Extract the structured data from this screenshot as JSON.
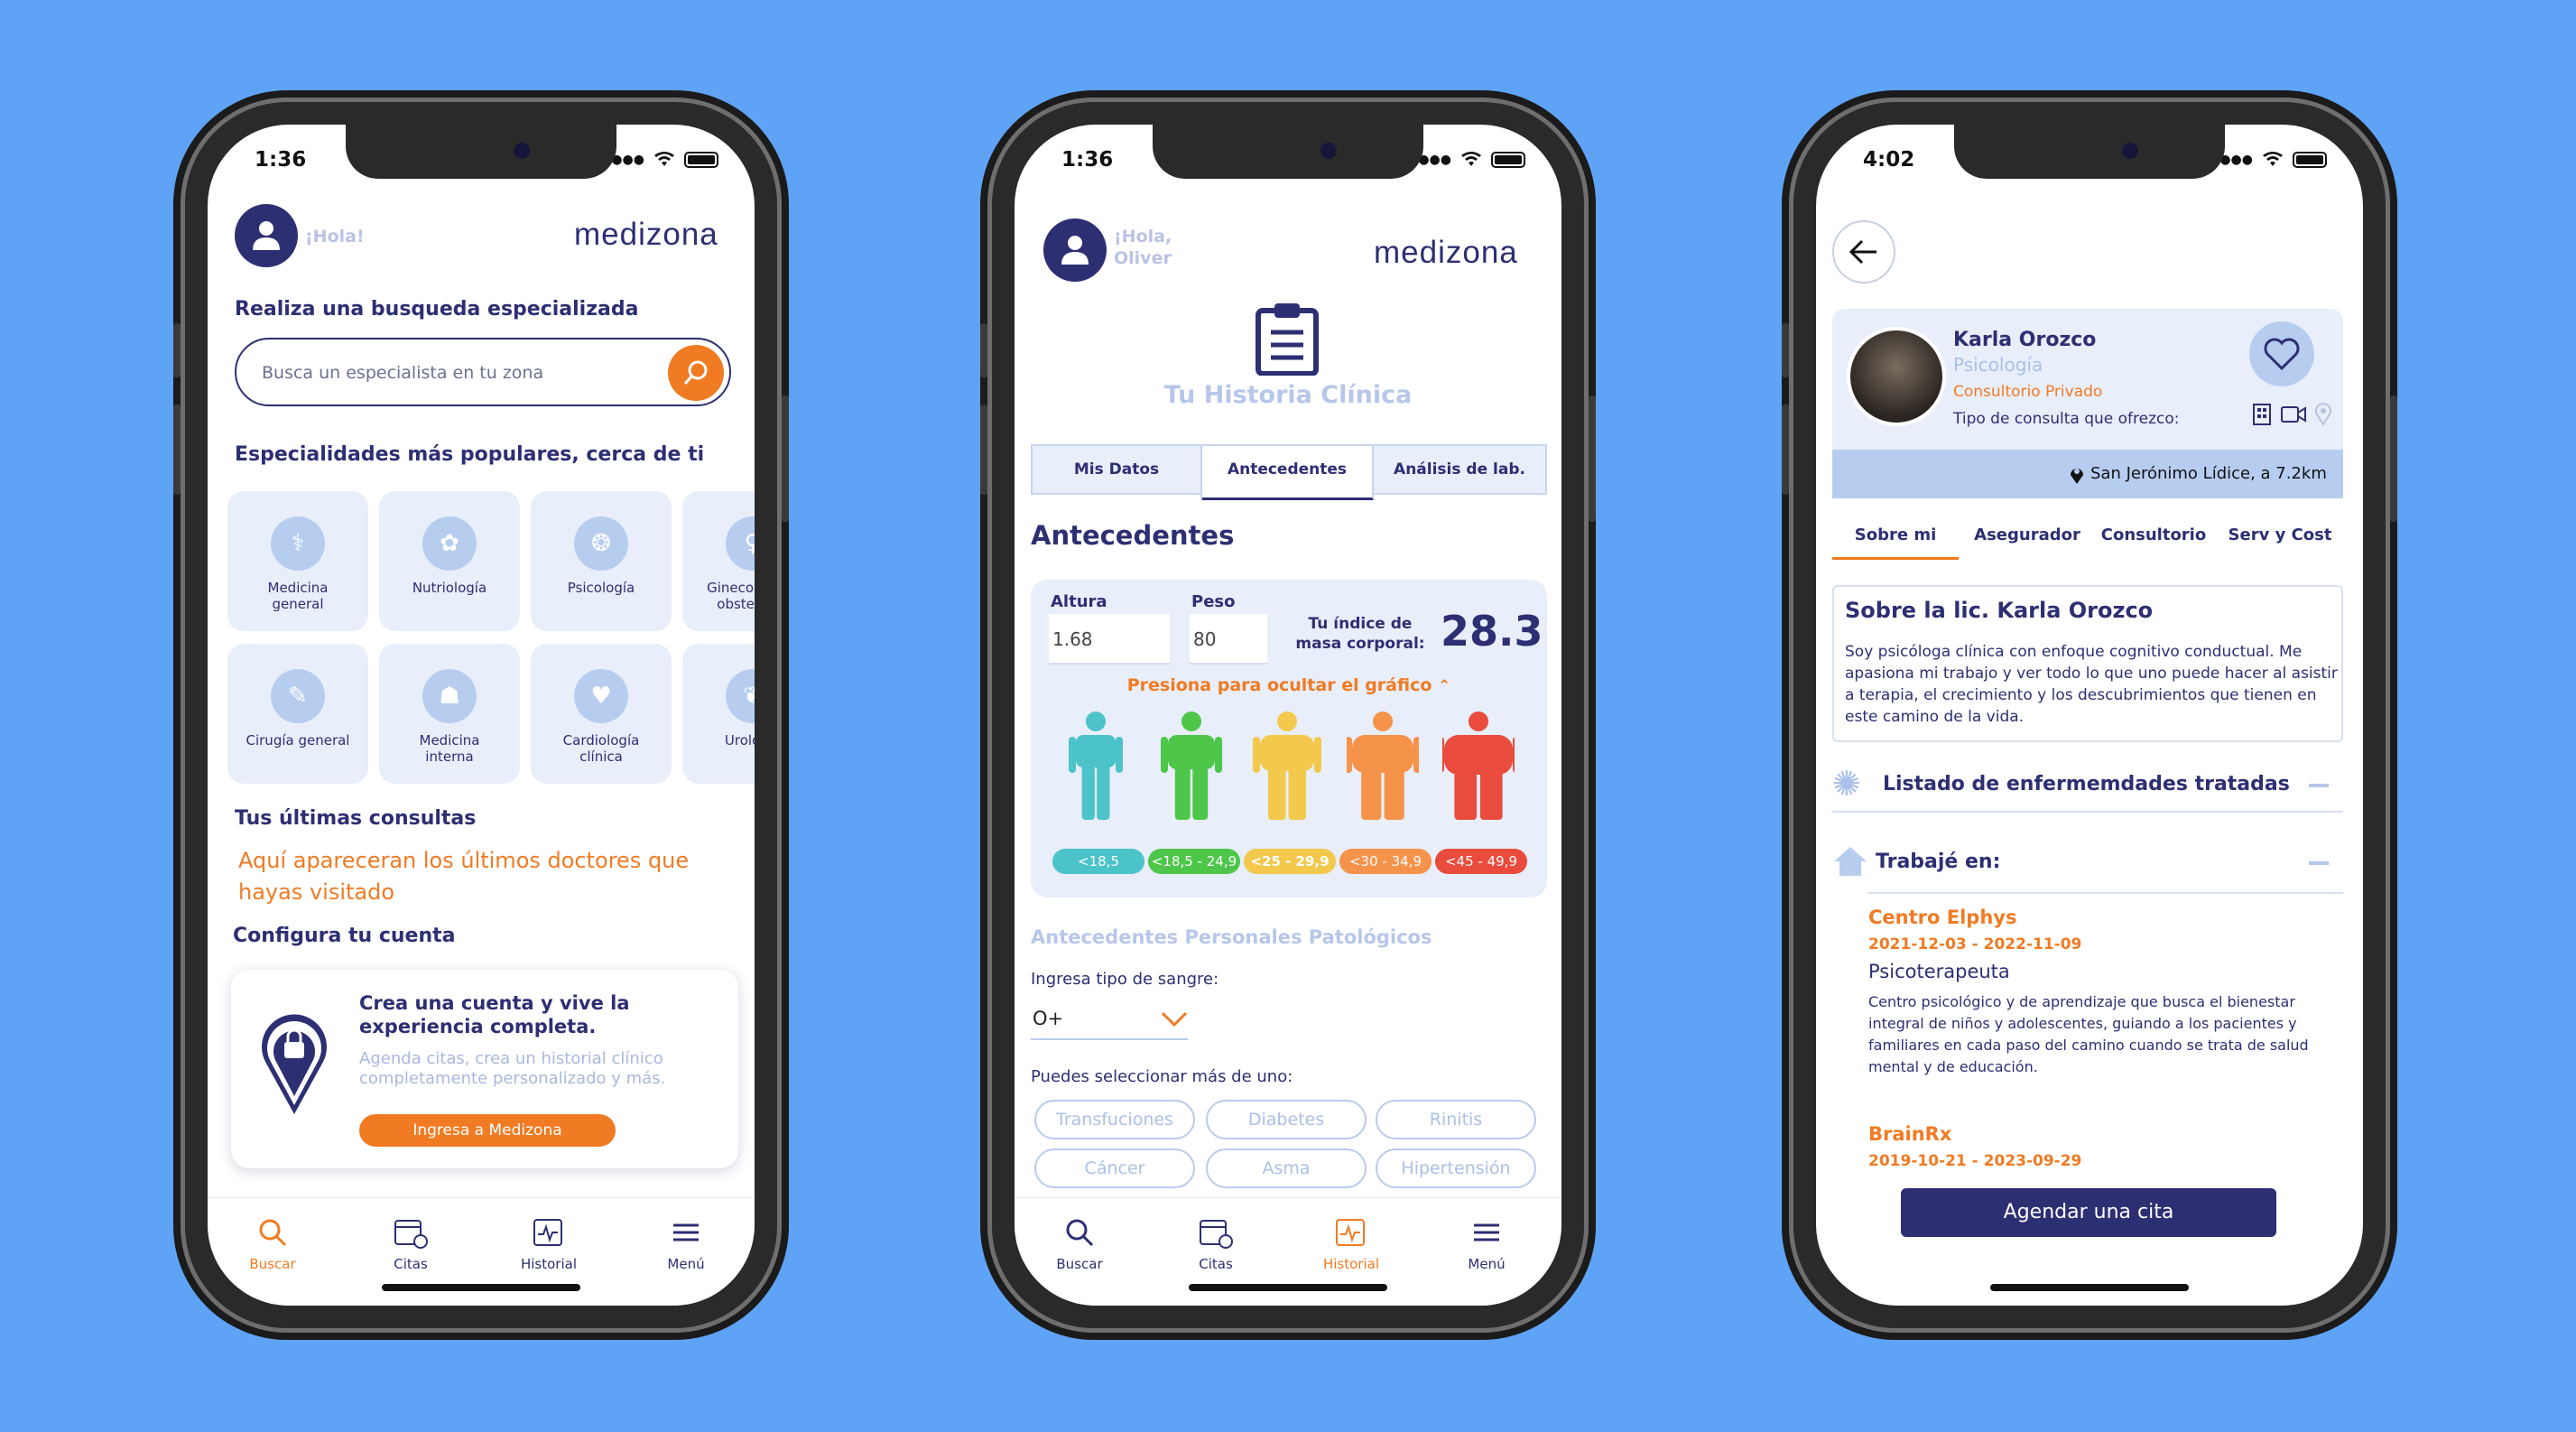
{
  "colors": {
    "background": "#5fa3f6",
    "navy": "#2d2f73",
    "orange": "#f07b23",
    "light": "#e8eefa"
  },
  "tabbar": {
    "search": "Buscar",
    "appointments": "Citas",
    "history": "Historial",
    "menu": "Menú"
  },
  "phone1": {
    "time": "1:36",
    "greeting": "¡Hola!",
    "logo": "medizona",
    "search_title": "Realiza una busqueda especializada",
    "search_placeholder": "Busca un especialista en tu zona",
    "popular_title": "Especialidades más populares, cerca de ti",
    "specialties": [
      "Medicina general",
      "Nutriología",
      "Psicología",
      "Ginecología y obstetricia",
      "Cirugía general",
      "Medicina interna",
      "Cardiología clínica",
      "Urología"
    ],
    "recent_title": "Tus últimas consultas",
    "recent_empty": "Aquí apareceran los últimos doctores que hayas visitado",
    "config_title": "Configura tu cuenta",
    "promo_title": "Crea una cuenta y vive la experiencia completa.",
    "promo_text": "Agenda citas, crea un historial clínico completamente personalizado y más.",
    "promo_button": "Ingresa a Medizona"
  },
  "phone2": {
    "time": "1:36",
    "greeting": "¡Hola, Oliver",
    "logo": "medizona",
    "title": "Tu Historia Clínica",
    "tabs": [
      "Mis Datos",
      "Antecedentes",
      "Análisis de lab."
    ],
    "section_title": "Antecedentes",
    "height_label": "Altura",
    "height_value": "1.68",
    "weight_label": "Peso",
    "weight_value": "80",
    "bmi_label": "Tu índice de masa corporal:",
    "bmi_value": "28.3",
    "toggle_chart": "Presiona para ocultar el gráfico",
    "bmi_ranges": [
      {
        "label": "<18,5",
        "color": "#4cc3c9"
      },
      {
        "label": "<18,5 - 24,9",
        "color": "#4ec64a"
      },
      {
        "label": "<25 - 29,9",
        "color": "#f2c94c"
      },
      {
        "label": "<30 - 34,9",
        "color": "#f6934a"
      },
      {
        "label": "<45 - 49,9",
        "color": "#e94b3c"
      }
    ],
    "pathological_title": "Antecedentes Personales Patológicos",
    "blood_label": "Ingresa tipo de sangre:",
    "blood_value": "O+",
    "multi_label": "Puedes seleccionar más de uno:",
    "conditions": [
      "Transfuciones",
      "Diabetes",
      "Rinitis",
      "Cáncer",
      "Asma",
      "Hipertensión"
    ]
  },
  "phone3": {
    "time": "4:02",
    "doctor_name": "Karla Orozco",
    "specialty": "Psicología",
    "office_type": "Consultorio Privado",
    "consult_label": "Tipo de consulta que ofrezco:",
    "location": "San Jerónimo Lídice, a 7.2km",
    "tabs": [
      "Sobre mi",
      "Asegurador",
      "Consultorio",
      "Serv y Cost"
    ],
    "about_title": "Sobre la lic. Karla Orozco",
    "about_text": "Soy psicóloga clínica con enfoque cognitivo conductual. Me apasiona mi trabajo y ver todo lo que uno puede hacer al asistir a terapia, el crecimiento y los descubrimientos que tienen en este camino de la vida.",
    "diseases_title": "Listado de enfermemdades tratadas",
    "worked_title": "Trabajé en:",
    "jobs": [
      {
        "company": "Centro Elphys",
        "dates": "2021-12-03 - 2022-11-09",
        "role": "Psicoterapeuta",
        "desc": "Centro psicológico y de aprendizaje que busca el bienestar integral de niños y adolescentes, guiando a los pacientes y familiares en cada paso del camino cuando se trata de salud mental y de educación."
      },
      {
        "company": "BrainRx",
        "dates": "2019-10-21 - 2023-09-29"
      }
    ],
    "cta": "Agendar una cita"
  }
}
